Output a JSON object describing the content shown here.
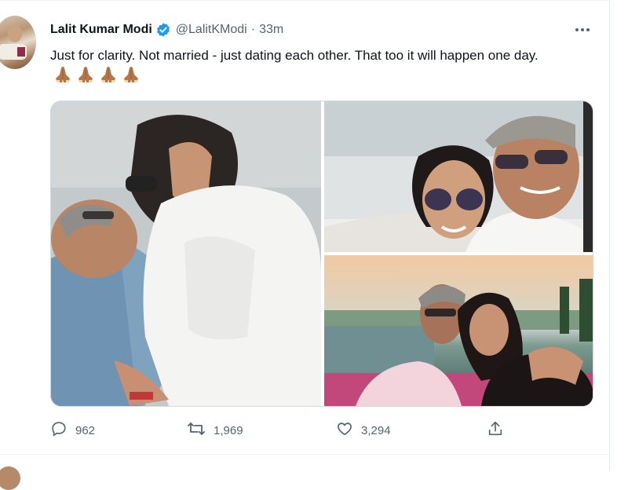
{
  "tweet": {
    "author_name": "Lalit Kumar Modi",
    "handle": "@LalitKModi",
    "separator": "·",
    "time": "33m",
    "text": "Just for clarity. Not married - just dating each other. That too it will happen one day.",
    "emoji_count": 4,
    "media": [
      {
        "name": "photo-1"
      },
      {
        "name": "photo-2"
      },
      {
        "name": "photo-3"
      }
    ]
  },
  "actions": {
    "reply_count": "962",
    "retweet_count": "1,969",
    "like_count": "3,294"
  },
  "colors": {
    "verified_blue": "#1d9bf0",
    "secondary_text": "#536471",
    "primary_text": "#0f1419",
    "border": "#cfd9de"
  },
  "icons": {
    "verified": "verified-badge-icon",
    "more": "more-icon",
    "reply": "reply-icon",
    "retweet": "retweet-icon",
    "like": "like-icon",
    "share": "share-icon",
    "emoji": "folded-hands-icon"
  }
}
